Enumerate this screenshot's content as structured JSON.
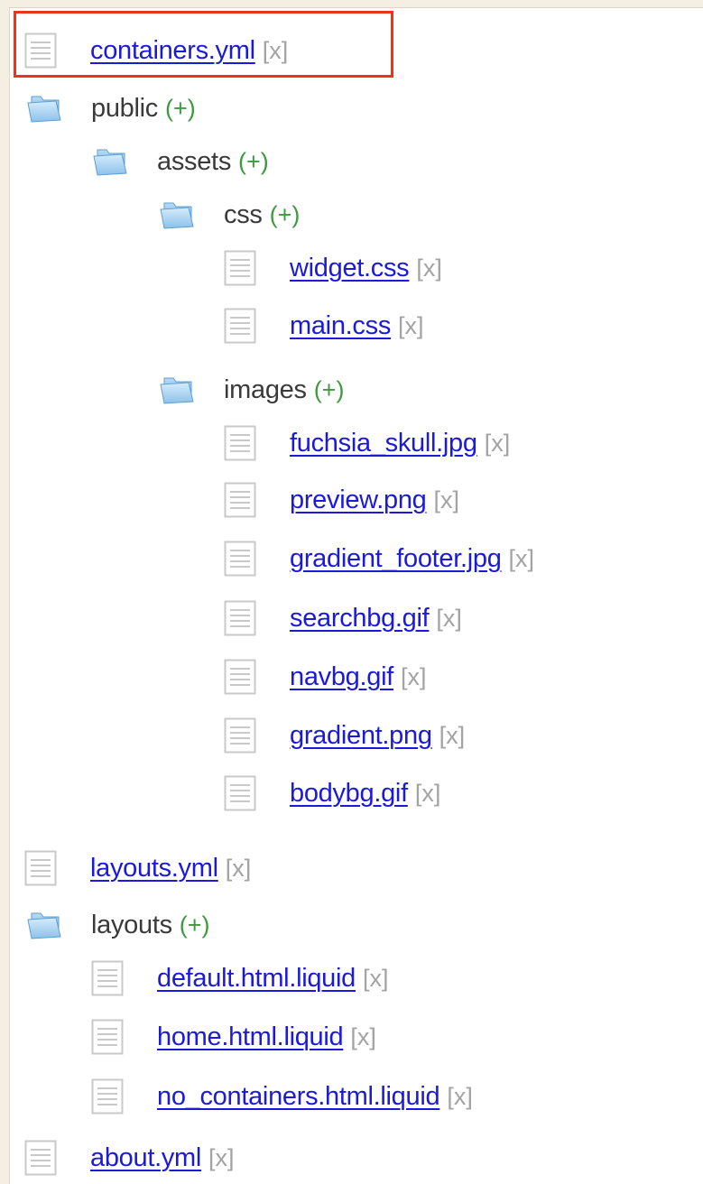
{
  "colors": {
    "page_background": "#f4efe2",
    "link": "#1a1ad8",
    "remove": "#a3a3a3",
    "add": "#3f9a3f",
    "highlight": "#e8351c"
  },
  "tree": {
    "remove_label": "[x]",
    "add_label": "(+)",
    "items": [
      {
        "kind": "file",
        "name": "containers.yml",
        "icon": "file-icon"
      },
      {
        "kind": "folder",
        "name": "public",
        "icon": "folder-icon"
      },
      {
        "kind": "folder",
        "name": "assets",
        "icon": "folder-icon"
      },
      {
        "kind": "folder",
        "name": "css",
        "icon": "folder-icon"
      },
      {
        "kind": "file",
        "name": "widget.css",
        "icon": "file-icon"
      },
      {
        "kind": "file",
        "name": "main.css",
        "icon": "file-icon"
      },
      {
        "kind": "folder",
        "name": "images",
        "icon": "folder-icon"
      },
      {
        "kind": "file",
        "name": "fuchsia_skull.jpg",
        "icon": "file-icon"
      },
      {
        "kind": "file",
        "name": "preview.png",
        "icon": "file-icon"
      },
      {
        "kind": "file",
        "name": "gradient_footer.jpg",
        "icon": "file-icon"
      },
      {
        "kind": "file",
        "name": "searchbg.gif",
        "icon": "file-icon"
      },
      {
        "kind": "file",
        "name": "navbg.gif",
        "icon": "file-icon"
      },
      {
        "kind": "file",
        "name": "gradient.png",
        "icon": "file-icon"
      },
      {
        "kind": "file",
        "name": "bodybg.gif",
        "icon": "file-icon"
      },
      {
        "kind": "file",
        "name": "layouts.yml",
        "icon": "file-icon"
      },
      {
        "kind": "folder",
        "name": "layouts",
        "icon": "folder-icon"
      },
      {
        "kind": "file",
        "name": "default.html.liquid",
        "icon": "file-icon"
      },
      {
        "kind": "file",
        "name": "home.html.liquid",
        "icon": "file-icon"
      },
      {
        "kind": "file",
        "name": "no_containers.html.liquid",
        "icon": "file-icon"
      },
      {
        "kind": "file",
        "name": "about.yml",
        "icon": "file-icon"
      }
    ]
  }
}
